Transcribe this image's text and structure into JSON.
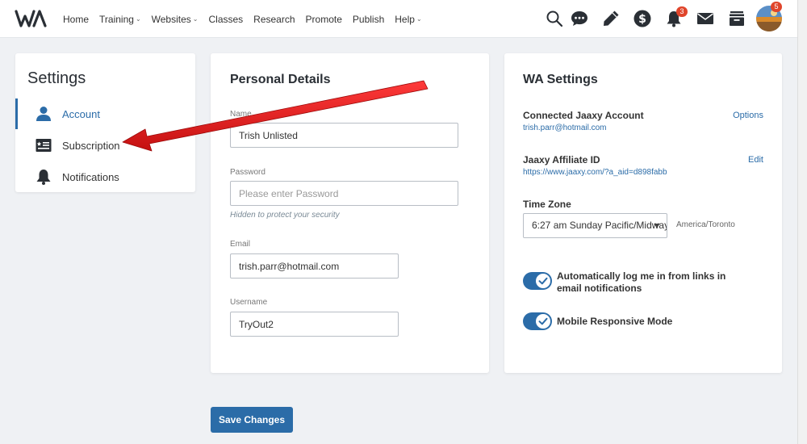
{
  "nav": {
    "items": [
      {
        "label": "Home",
        "dropdown": false
      },
      {
        "label": "Training",
        "dropdown": true
      },
      {
        "label": "Websites",
        "dropdown": true
      },
      {
        "label": "Classes",
        "dropdown": false
      },
      {
        "label": "Research",
        "dropdown": false
      },
      {
        "label": "Promote",
        "dropdown": false
      },
      {
        "label": "Publish",
        "dropdown": false
      },
      {
        "label": "Help",
        "dropdown": true
      }
    ],
    "notifications_count": "3",
    "avatar_count": "5"
  },
  "sidebar": {
    "title": "Settings",
    "items": [
      {
        "label": "Account",
        "icon": "user-icon"
      },
      {
        "label": "Subscription",
        "icon": "id-card-icon"
      },
      {
        "label": "Notifications",
        "icon": "bell-icon"
      }
    ]
  },
  "personal": {
    "title": "Personal Details",
    "name_label": "Name",
    "name_value": "Trish Unlisted",
    "password_label": "Password",
    "password_placeholder": "Please enter Password",
    "password_helper": "Hidden to protect your security",
    "email_label": "Email",
    "email_value": "trish.parr@hotmail.com",
    "username_label": "Username",
    "username_value": "TryOut2"
  },
  "wa": {
    "title": "WA Settings",
    "jaaxy_label": "Connected Jaaxy Account",
    "jaaxy_value": "trish.parr@hotmail.com",
    "jaaxy_link": "Options",
    "affiliate_label": "Jaaxy Affiliate ID",
    "affiliate_value": "https://www.jaaxy.com/?a_aid=d898fabb",
    "affiliate_link": "Edit",
    "timezone_label": "Time Zone",
    "timezone_value": "6:27 am Sunday Pacific/Midway",
    "timezone_note": "America/Toronto",
    "toggle1_line1": "Automatically log me in from links in",
    "toggle1_line2": "email notifications",
    "toggle2_label": "Mobile Responsive Mode"
  },
  "save_label": "Save Changes",
  "colors": {
    "accent": "#2b6ca8",
    "badge": "#e0452b",
    "arrow": "#e01e1e"
  }
}
